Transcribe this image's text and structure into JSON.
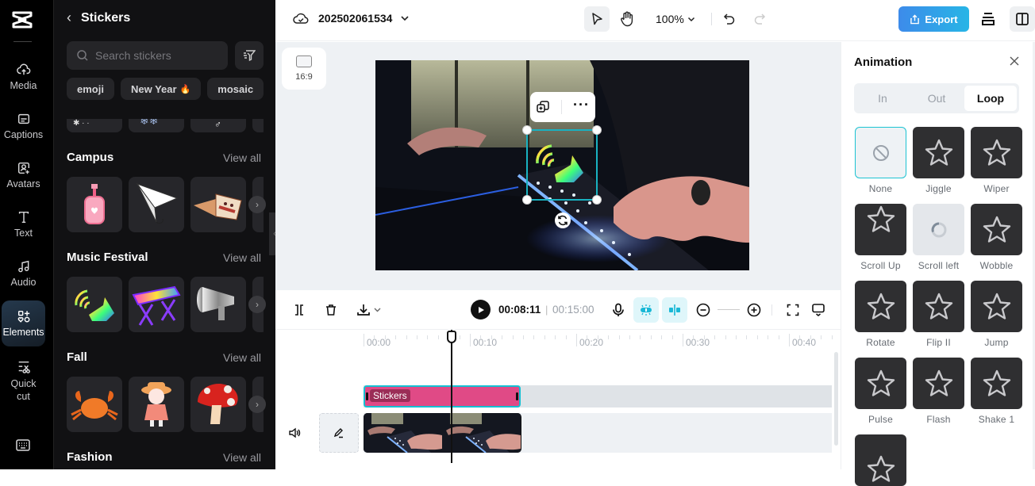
{
  "rail": {
    "items": [
      {
        "label": "Media",
        "icon": "cloud-upload-icon"
      },
      {
        "label": "Captions",
        "icon": "captions-icon"
      },
      {
        "label": "Avatars",
        "icon": "avatar-icon"
      },
      {
        "label": "Text",
        "icon": "text-icon"
      },
      {
        "label": "Audio",
        "icon": "music-icon"
      },
      {
        "label": "Elements",
        "icon": "elements-icon",
        "active": true
      },
      {
        "label": "Quick cut",
        "icon": "quick-cut-icon"
      }
    ],
    "keyboard_icon": "keyboard-icon"
  },
  "panel": {
    "title": "Stickers",
    "search_placeholder": "Search stickers",
    "chips": [
      "emoji",
      "New Year",
      "mosaic"
    ],
    "chip_hot_icon": "🔥",
    "view_all": "View all",
    "sections": [
      {
        "title": "Campus",
        "items": [
          "pink-bottle-sticker",
          "paper-plane-sticker",
          "flying-book-sticker"
        ]
      },
      {
        "title": "Music Festival",
        "items": [
          "rainbow-speaker-sticker",
          "rainbow-keyboard-sticker",
          "megaphone-sticker"
        ]
      },
      {
        "title": "Fall",
        "items": [
          "crab-sticker",
          "girl-hat-sticker",
          "mushroom-sticker"
        ]
      },
      {
        "title": "Fashion",
        "items": []
      }
    ]
  },
  "topbar": {
    "project_name": "202502061534",
    "zoom": "100%",
    "export_label": "Export"
  },
  "stage": {
    "aspect_ratio": "16:9"
  },
  "timeline_toolbar": {
    "current_time": "00:08:11",
    "separator": "|",
    "total_time": "00:15:00"
  },
  "timeline": {
    "ruler": [
      "00:00",
      "00:10",
      "00:20",
      "00:30",
      "00:40"
    ],
    "sticker_clip_label": "Stickers"
  },
  "animation": {
    "title": "Animation",
    "tabs": [
      {
        "label": "In"
      },
      {
        "label": "Out"
      },
      {
        "label": "Loop",
        "active": true
      }
    ],
    "options": [
      {
        "name": "None",
        "kind": "none",
        "selected": true
      },
      {
        "name": "Jiggle",
        "kind": "star"
      },
      {
        "name": "Wiper",
        "kind": "star"
      },
      {
        "name": "Scroll Up",
        "kind": "star"
      },
      {
        "name": "Scroll left",
        "kind": "loading"
      },
      {
        "name": "Wobble",
        "kind": "star"
      },
      {
        "name": "Rotate",
        "kind": "star"
      },
      {
        "name": "Flip II",
        "kind": "star"
      },
      {
        "name": "Jump",
        "kind": "star"
      },
      {
        "name": "Pulse",
        "kind": "star"
      },
      {
        "name": "Flash",
        "kind": "star"
      },
      {
        "name": "Shake 1",
        "kind": "star"
      },
      {
        "name": "",
        "kind": "star"
      }
    ]
  }
}
